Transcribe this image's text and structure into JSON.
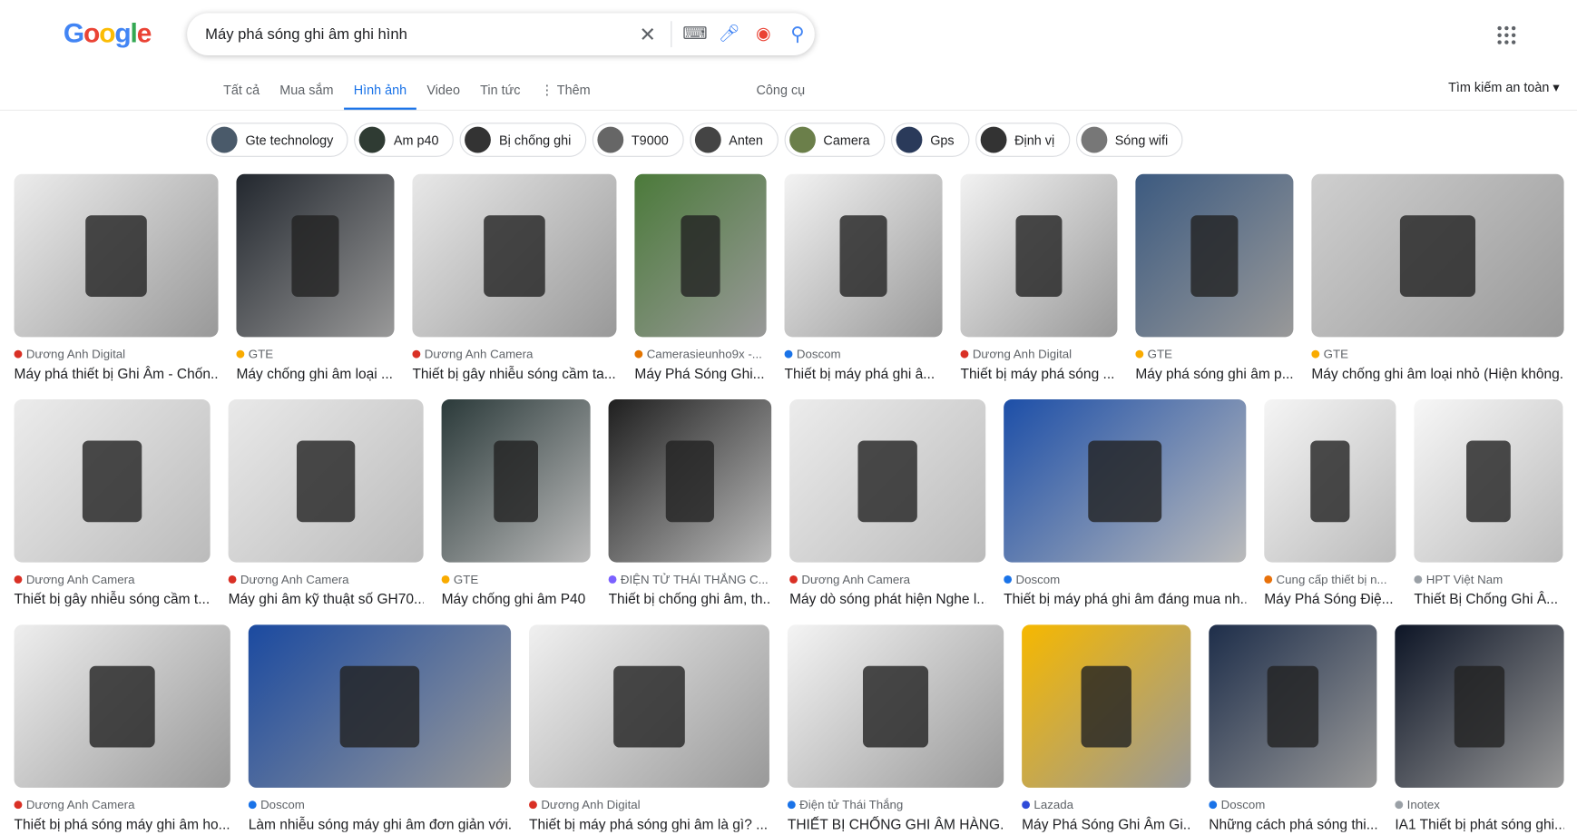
{
  "logo": "Google",
  "search": {
    "query": "Máy phá sóng ghi âm ghi hình"
  },
  "tabs": [
    "Tất cả",
    "Mua sắm",
    "Hình ảnh",
    "Video",
    "Tin tức",
    "⋮ Thêm"
  ],
  "active_tab": "Hình ảnh",
  "tools": "Công cụ",
  "safe_search": "Tìm kiếm an toàn ▾",
  "chips": [
    "Gte technology",
    "Am p40",
    "Bị chống ghi",
    "T9000",
    "Anten",
    "Camera",
    "Gps",
    "Định vị",
    "Sóng wifi"
  ],
  "rows": [
    [
      {
        "source": "Dương Anh Digital",
        "title": "Máy phá thiết bị Ghi Âm - Chốn...",
        "fav": "#d93025",
        "bg": "#ececec"
      },
      {
        "source": "GTE",
        "title": "Máy chống ghi âm loại ...",
        "fav": "#f9ab00",
        "bg": "#22272e"
      },
      {
        "source": "Dương Anh Camera",
        "title": "Thiết bị gây nhiễu sóng cầm ta...",
        "fav": "#d93025",
        "bg": "#e8e8e8"
      },
      {
        "source": "Camerasieunho9x -...",
        "title": "Máy Phá Sóng Ghi...",
        "fav": "#e37400",
        "bg": "#4b7a3a"
      },
      {
        "source": "Doscom",
        "title": "Thiết bị máy phá ghi â...",
        "fav": "#1a73e8",
        "bg": "#f3f3f3"
      },
      {
        "source": "Dương Anh Digital",
        "title": "Thiết bị máy phá sóng ...",
        "fav": "#d93025",
        "bg": "#f2f2f2"
      },
      {
        "source": "GTE",
        "title": "Máy phá sóng ghi âm p...",
        "fav": "#f9ab00",
        "bg": "#3c5a80"
      },
      {
        "source": "GTE",
        "title": "Máy chống ghi âm loại nhỏ (Hiện không...",
        "fav": "#f9ab00",
        "bg": "#cfcfcf"
      }
    ],
    [
      {
        "source": "Dương Anh Camera",
        "title": "Thiết bị gây nhiễu sóng cầm t...",
        "fav": "#d93025",
        "bg": "#ececec"
      },
      {
        "source": "Dương Anh Camera",
        "title": "Máy ghi âm kỹ thuật số GH70...",
        "fav": "#d93025",
        "bg": "#e9e9e9"
      },
      {
        "source": "GTE",
        "title": "Máy chống ghi âm P40",
        "fav": "#f9ab00",
        "bg": "#2b3a3a"
      },
      {
        "source": "ĐIỆN TỬ THÁI THẮNG C...",
        "title": "Thiết bị chống ghi âm, th...",
        "fav": "#7b61ff",
        "bg": "#1f1f1f"
      },
      {
        "source": "Dương Anh Camera",
        "title": "Máy dò sóng phát hiện Nghe l...",
        "fav": "#d93025",
        "bg": "#ececec"
      },
      {
        "source": "Doscom",
        "title": "Thiết bị máy phá ghi âm đáng mua nh...",
        "fav": "#1a73e8",
        "bg": "#1d4fa8"
      },
      {
        "source": "Cung cấp thiết bị n...",
        "title": "Máy Phá Sóng Điệ...",
        "fav": "#e8710a",
        "bg": "#f5f5f5"
      },
      {
        "source": "HPT Việt Nam",
        "title": "Thiết Bị Chống Ghi Â...",
        "fav": "#9aa0a6",
        "bg": "#f7f7f7"
      }
    ],
    [
      {
        "source": "Dương Anh Camera",
        "title": "Thiết bị phá sóng máy ghi âm ho...",
        "fav": "#d93025",
        "bg": "#eeeeee"
      },
      {
        "source": "Doscom",
        "title": "Làm nhiễu sóng máy ghi âm đơn giản với...",
        "fav": "#1a73e8",
        "bg": "#1b4aa0"
      },
      {
        "source": "Dương Anh Digital",
        "title": "Thiết bị máy phá sóng ghi âm là gì? ...",
        "fav": "#d93025",
        "bg": "#f0f0f0"
      },
      {
        "source": "Điện tử Thái Thắng",
        "title": "THIẾT BỊ CHỐNG GHI ÂM HÀNG...",
        "fav": "#1a73e8",
        "bg": "#f4f4f4"
      },
      {
        "source": "Lazada",
        "title": "Máy Phá Sóng Ghi Âm Gi...",
        "fav": "#2f4bd8",
        "bg": "#f6b800"
      },
      {
        "source": "Doscom",
        "title": "Những cách phá sóng thi...",
        "fav": "#1a73e8",
        "bg": "#1e2e4a"
      },
      {
        "source": "Inotex",
        "title": "IA1 Thiết bị phát sóng ghi...",
        "fav": "#9aa0a6",
        "bg": "#0d1526"
      }
    ]
  ]
}
